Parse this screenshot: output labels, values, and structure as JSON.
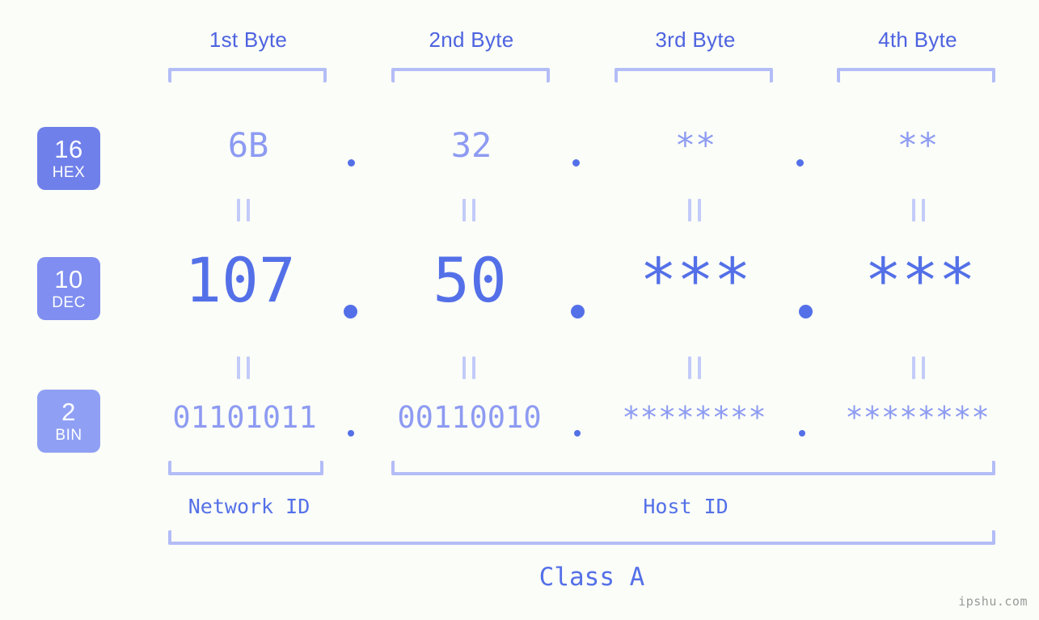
{
  "meta": {
    "background": "#fbfdf8",
    "accent": "#5470e8",
    "accent_light": "#8d9bf2",
    "bracket": "#b3bdf7",
    "badge_hex": "#7080ea",
    "badge_dec": "#7f8ef0",
    "badge_bin": "#8fa0f4"
  },
  "headers": [
    {
      "label": "1st Byte"
    },
    {
      "label": "2nd Byte"
    },
    {
      "label": "3rd Byte"
    },
    {
      "label": "4th Byte"
    }
  ],
  "bases": [
    {
      "num": "16",
      "label": "HEX"
    },
    {
      "num": "10",
      "label": "DEC"
    },
    {
      "num": "2",
      "label": "BIN"
    }
  ],
  "rows": {
    "hex": {
      "base": "16",
      "base_label": "HEX",
      "values": [
        "6B",
        "32",
        "**",
        "**"
      ],
      "separator": "."
    },
    "dec": {
      "base": "10",
      "base_label": "DEC",
      "values": [
        "107",
        "50",
        "***",
        "***"
      ],
      "separator": "."
    },
    "bin": {
      "base": "2",
      "base_label": "BIN",
      "values": [
        "01101011",
        "00110010",
        "********",
        "********"
      ],
      "separator": "."
    }
  },
  "equality_symbol": "=",
  "sections": {
    "network_id": "Network ID",
    "host_id": "Host ID",
    "class": "Class A"
  },
  "watermark": "ipshu.com"
}
